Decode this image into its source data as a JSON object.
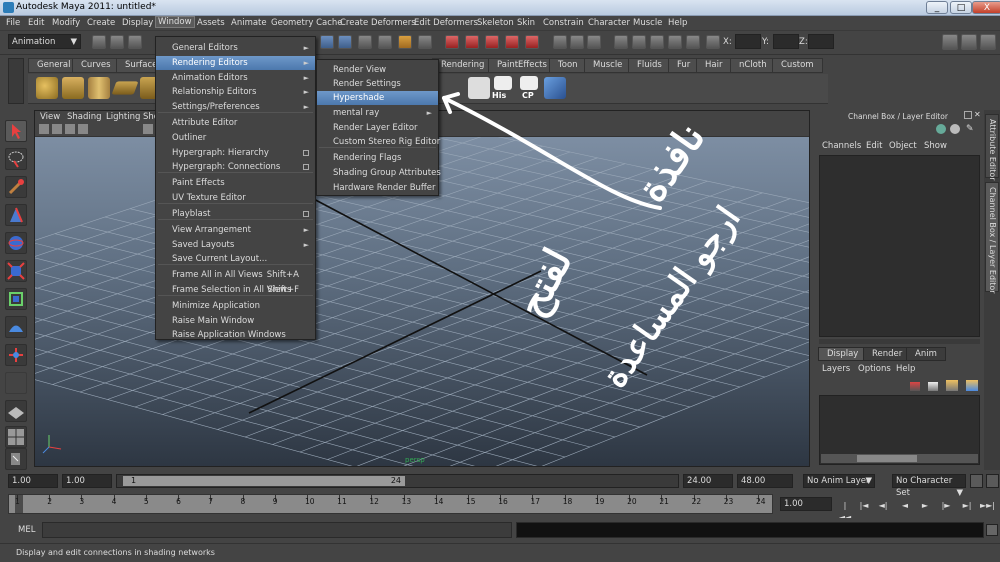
{
  "window": {
    "title": "Autodesk Maya 2011: untitled*",
    "controls": [
      "_",
      "□",
      "X"
    ]
  },
  "menubar": {
    "items": [
      "File",
      "Edit",
      "Modify",
      "Create",
      "Display",
      "Window",
      "Assets",
      "Animate",
      "Geometry Cache",
      "Create Deformers",
      "Edit Deformers",
      "Skeleton",
      "Skin",
      "Constrain",
      "Character",
      "Muscle",
      "Help"
    ],
    "active": "Window"
  },
  "statusline": {
    "mode": "Animation",
    "coords": [
      "X:",
      "Y:",
      "Z:"
    ]
  },
  "shelf": {
    "tabs": [
      "General",
      "Curves",
      "Surfaces",
      "Rendering",
      "PaintEffects",
      "Toon",
      "Muscle",
      "Fluids",
      "Fur",
      "Hair",
      "nCloth",
      "Custom"
    ],
    "icon_labels": [
      "His",
      "CP"
    ]
  },
  "viewport": {
    "menu": [
      "View",
      "Shading",
      "Lighting",
      "Sho"
    ],
    "accent": "#6e98c9",
    "grid_color": "#9aa8b8"
  },
  "window_menu": {
    "items": [
      {
        "label": "General Editors",
        "type": "sub"
      },
      {
        "label": "Rendering Editors",
        "type": "sub",
        "highlighted": true
      },
      {
        "label": "Animation Editors",
        "type": "sub"
      },
      {
        "label": "Relationship Editors",
        "type": "sub"
      },
      {
        "label": "Settings/Preferences",
        "type": "sub"
      },
      {
        "label": "Attribute Editor"
      },
      {
        "label": "Outliner"
      },
      {
        "label": "Hypergraph: Hierarchy",
        "type": "opt"
      },
      {
        "label": "Hypergraph: Connections",
        "type": "opt"
      },
      {
        "label": "Paint Effects"
      },
      {
        "label": "UV Texture Editor"
      },
      {
        "label": "Playblast",
        "type": "opt"
      },
      {
        "label": "View Arrangement",
        "type": "sub"
      },
      {
        "label": "Saved Layouts",
        "type": "sub"
      },
      {
        "label": "Save Current Layout..."
      },
      {
        "label": "Frame All in All Views",
        "shortcut": "Shift+A"
      },
      {
        "label": "Frame Selection in All Views",
        "shortcut": "Shift+F"
      },
      {
        "label": "Minimize Application"
      },
      {
        "label": "Raise Main Window"
      },
      {
        "label": "Raise Application Windows"
      }
    ]
  },
  "rendering_menu": {
    "items": [
      {
        "label": "Render View"
      },
      {
        "label": "Render Settings"
      },
      {
        "label": "Hypershade",
        "highlighted": true
      },
      {
        "label": "mental ray",
        "type": "sub"
      },
      {
        "label": "Render Layer Editor"
      },
      {
        "label": "Custom Stereo Rig Editor"
      },
      {
        "label": "Rendering Flags"
      },
      {
        "label": "Shading Group Attributes"
      },
      {
        "label": "Hardware Render Buffer"
      }
    ]
  },
  "annotation": {
    "lines": [
      "نافذة",
      "لفتح",
      "ارجو المساعدة"
    ],
    "color": "#ffffff"
  },
  "channel_box": {
    "title": "Channel Box / Layer Editor",
    "menu": [
      "Channels",
      "Edit",
      "Object",
      "Show"
    ]
  },
  "layer_editor": {
    "tabs": [
      "Display",
      "Render",
      "Anim"
    ],
    "active": "Display",
    "menu": [
      "Layers",
      "Options",
      "Help"
    ]
  },
  "side_tabs": [
    "Attribute Editor",
    "Channel Box / Layer Editor"
  ],
  "time_slider": {
    "start": "1.00",
    "range_start": "1.00",
    "range_slider_start": "1",
    "range_slider_end": "24",
    "range_end": "24.00",
    "end": "48.00",
    "anim_layer": "No Anim Layer",
    "char_set": "No Character Set",
    "current_frame": "1.00",
    "ticks": [
      "1",
      "2",
      "3",
      "4",
      "5",
      "6",
      "7",
      "8",
      "9",
      "10",
      "11",
      "12",
      "13",
      "14",
      "15",
      "16",
      "17",
      "18",
      "19",
      "20",
      "21",
      "22",
      "23",
      "24"
    ],
    "playback": [
      "|◄◄",
      "|◄",
      "◄|",
      "◄",
      "►",
      "|►",
      "►|",
      "►►|"
    ]
  },
  "command_line": {
    "label": "MEL"
  },
  "help_line": {
    "text": "Display and edit connections in shading networks"
  }
}
